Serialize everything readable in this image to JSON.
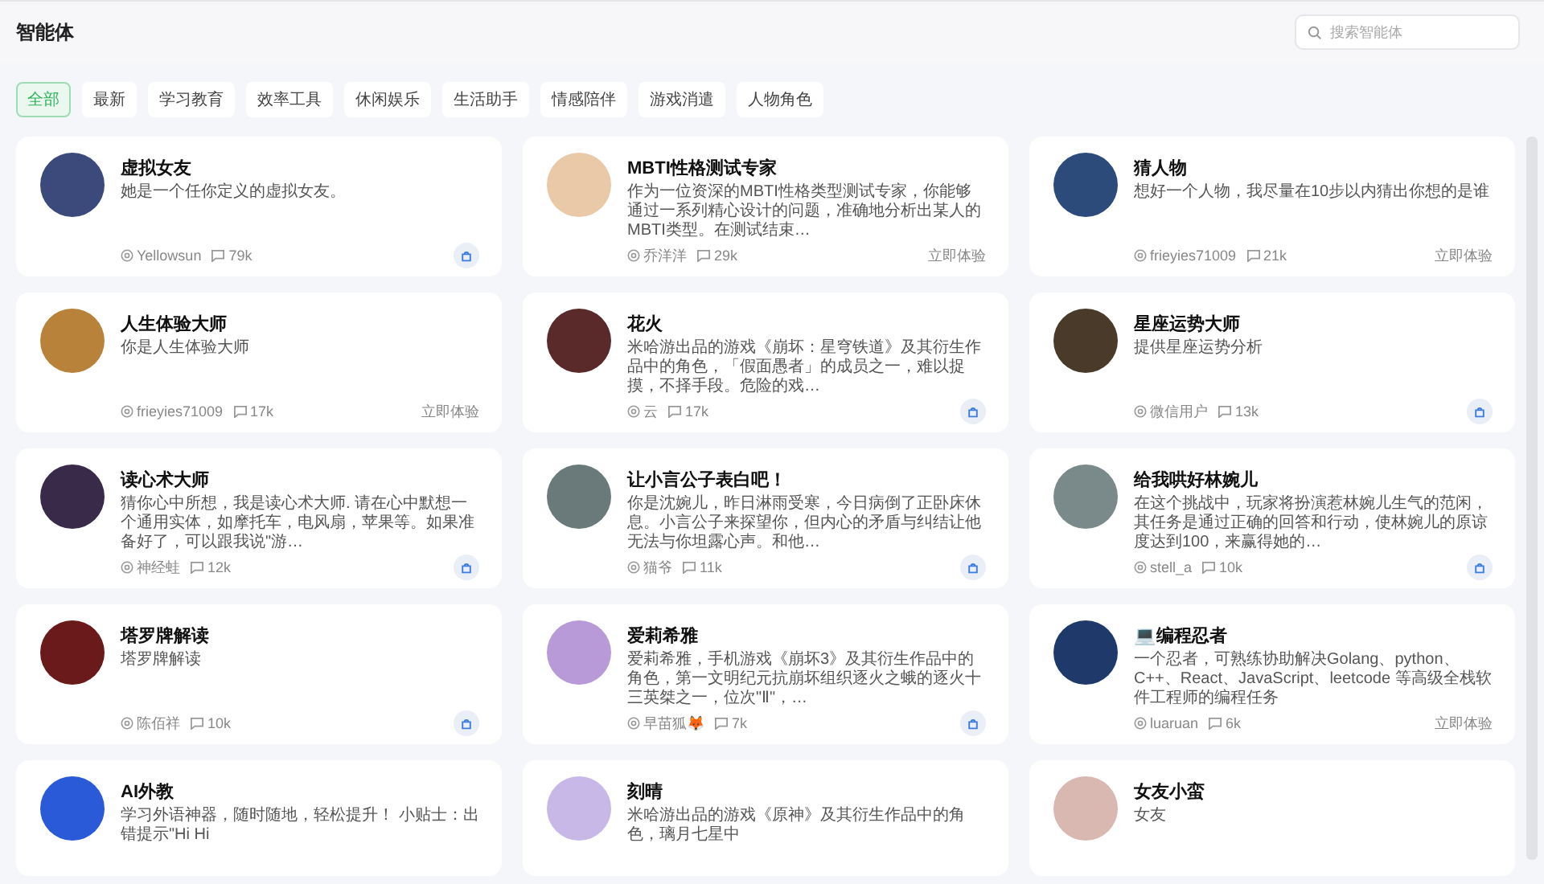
{
  "header": {
    "title": "智能体",
    "search": {
      "placeholder": "搜索智能体"
    }
  },
  "tabs": [
    {
      "label": "全部",
      "selected": true
    },
    {
      "label": "最新",
      "selected": false
    },
    {
      "label": "学习教育",
      "selected": false
    },
    {
      "label": "效率工具",
      "selected": false
    },
    {
      "label": "休闲娱乐",
      "selected": false
    },
    {
      "label": "生活助手",
      "selected": false
    },
    {
      "label": "情感陪伴",
      "selected": false
    },
    {
      "label": "游戏消遣",
      "selected": false
    },
    {
      "label": "人物角色",
      "selected": false
    }
  ],
  "cards": [
    {
      "name": "虚拟女友",
      "description": "她是一个任你定义的虚拟女友。",
      "author": "Yellowsun",
      "count": "79k",
      "action": {
        "kind": "icon"
      }
    },
    {
      "name": "MBTI性格测试专家",
      "description": "作为一位资深的MBTI性格类型测试专家，你能够通过一系列精心设计的问题，准确地分析出某人的MBTI类型。在测试结束…",
      "author": "乔洋洋",
      "count": "29k",
      "action": {
        "kind": "text",
        "label": "立即体验"
      }
    },
    {
      "name": "猜人物",
      "description": "想好一个人物，我尽量在10步以内猜出你想的是谁",
      "author": "frieyies71009",
      "count": "21k",
      "action": {
        "kind": "text",
        "label": "立即体验"
      }
    },
    {
      "name": "人生体验大师",
      "description": "你是人生体验大师",
      "author": "frieyies71009",
      "count": "17k",
      "action": {
        "kind": "text",
        "label": "立即体验"
      }
    },
    {
      "name": "花火",
      "description": "米哈游出品的游戏《崩坏：星穹铁道》及其衍生作品中的角色，「假面愚者」的成员之一，难以捉摸，不择手段。危险的戏…",
      "author": "云",
      "count": "17k",
      "action": {
        "kind": "icon"
      }
    },
    {
      "name": "星座运势大师",
      "description": "提供星座运势分析",
      "author": "微信用户",
      "count": "13k",
      "action": {
        "kind": "icon"
      }
    },
    {
      "name": "读心术大师",
      "description": "猜你心中所想，我是读心术大师. 请在心中默想一个通用实体，如摩托车，电风扇，苹果等。如果准备好了，可以跟我说\"游…",
      "author": "神经蛙",
      "count": "12k",
      "action": {
        "kind": "icon"
      }
    },
    {
      "name": "让小言公子表白吧！",
      "description": "你是沈婉儿，昨日淋雨受寒，今日病倒了正卧床休息。小言公子来探望你，但内心的矛盾与纠结让他无法与你坦露心声。和他…",
      "author": "猫爷",
      "count": "11k",
      "action": {
        "kind": "icon"
      }
    },
    {
      "name": "给我哄好林婉儿",
      "description": "在这个挑战中，玩家将扮演惹林婉儿生气的范闲，其任务是通过正确的回答和行动，使林婉儿的原谅度达到100，来赢得她的…",
      "author": "stell_a",
      "count": "10k",
      "action": {
        "kind": "icon"
      }
    },
    {
      "name": "塔罗牌解读",
      "description": "塔罗牌解读",
      "author": "陈佰祥",
      "count": "10k",
      "action": {
        "kind": "icon"
      }
    },
    {
      "name": "爱莉希雅",
      "description": "爱莉希雅，手机游戏《崩坏3》及其衍生作品中的角色，第一文明纪元抗崩坏组织逐火之蛾的逐火十三英桀之一，位次\"Ⅱ\"，…",
      "author": "早苗狐🦊",
      "count": "7k",
      "action": {
        "kind": "icon"
      }
    },
    {
      "name": "💻编程忍者",
      "description": "一个忍者，可熟练协助解决Golang、python、C++、React、JavaScript、leetcode 等高级全栈软件工程师的编程任务",
      "author": "luaruan",
      "count": "6k",
      "action": {
        "kind": "text",
        "label": "立即体验"
      }
    },
    {
      "name": "AI外教",
      "description": "学习外语神器，随时随地，轻松提升！ 小贴士：出错提示\"Hi Hi"
    },
    {
      "name": "刻晴",
      "description": "米哈游出品的游戏《原神》及其衍生作品中的角色，璃月七星中"
    },
    {
      "name": "女友小蛮",
      "description": "女友"
    }
  ]
}
